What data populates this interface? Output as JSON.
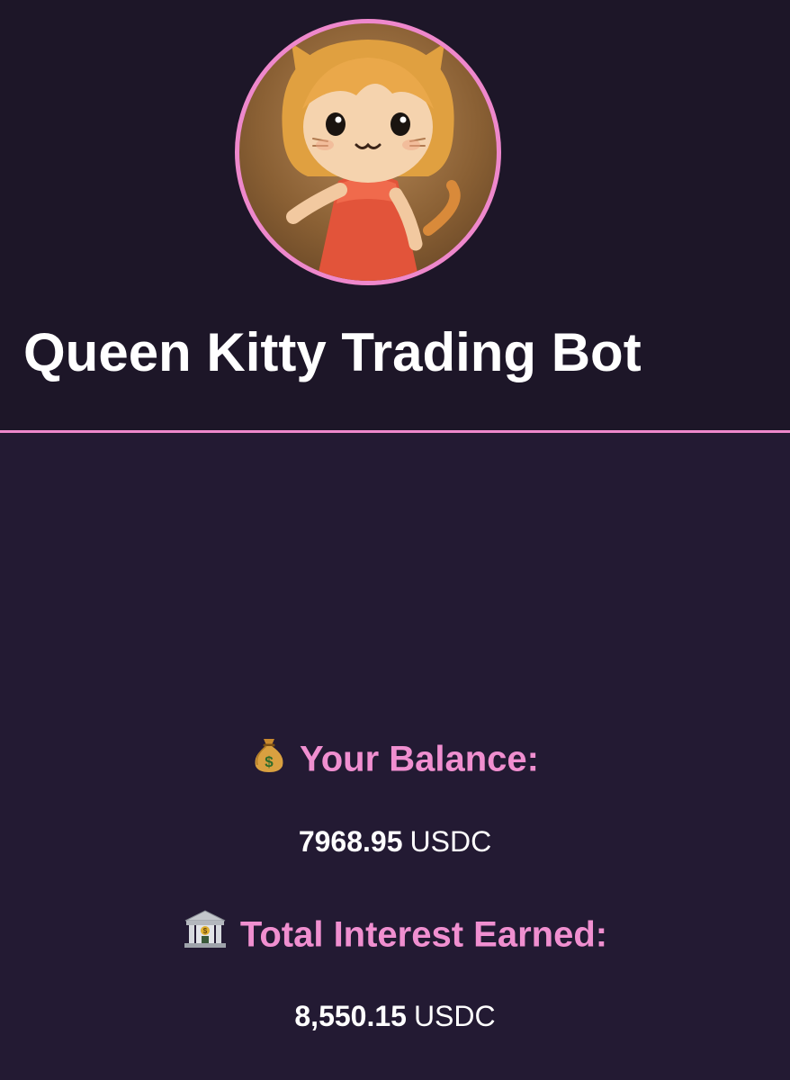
{
  "app": {
    "title": "Queen Kitty Trading Bot",
    "avatar_alt": "kitty-girl-figurine"
  },
  "balance": {
    "icon": "money-bag-icon",
    "label": "Your Balance:",
    "value": "7968.95",
    "unit": "USDC"
  },
  "interest": {
    "icon": "bank-icon",
    "label": "Total Interest Earned:",
    "value": "8,550.15",
    "unit": "USDC"
  },
  "colors": {
    "background": "#231a33",
    "header_background": "#1d1628",
    "accent_pink": "#ee88cc",
    "label_pink": "#f08fd0",
    "text": "#ffffff"
  }
}
